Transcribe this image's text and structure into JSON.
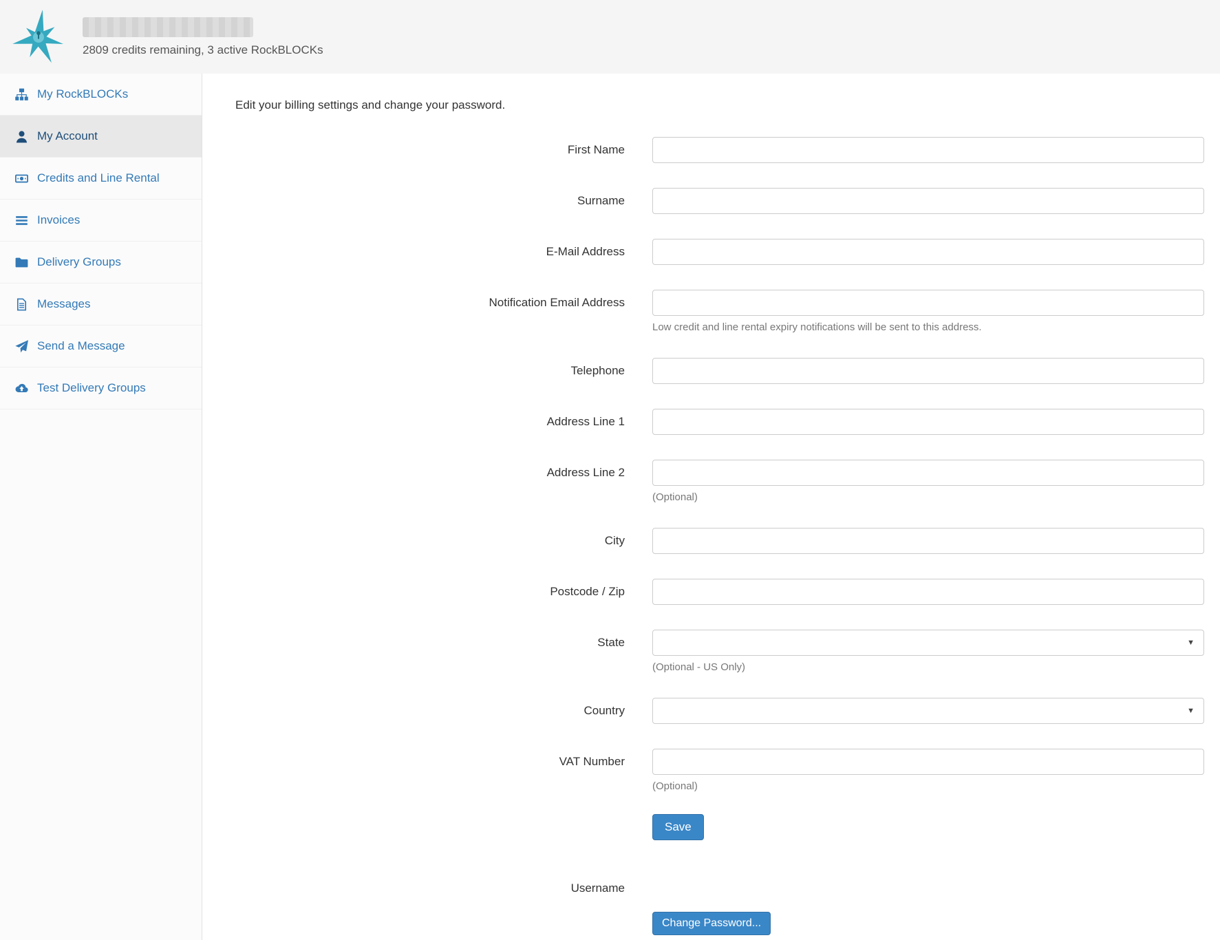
{
  "header": {
    "credits_text": "2809 credits remaining, 3 active RockBLOCKs"
  },
  "colors": {
    "accent_blue": "#3a87c8",
    "sidebar_link": "#337ab7",
    "active_item_bg": "#e8e8e8",
    "logo_teal": "#35a9c0"
  },
  "sidebar": {
    "items": [
      {
        "label": "My RockBLOCKs",
        "icon": "sitemap-icon",
        "active": false
      },
      {
        "label": "My Account",
        "icon": "user-icon",
        "active": true
      },
      {
        "label": "Credits and Line Rental",
        "icon": "money-icon",
        "active": false
      },
      {
        "label": "Invoices",
        "icon": "list-icon",
        "active": false
      },
      {
        "label": "Delivery Groups",
        "icon": "folder-icon",
        "active": false
      },
      {
        "label": "Messages",
        "icon": "file-icon",
        "active": false
      },
      {
        "label": "Send a Message",
        "icon": "paper-plane-icon",
        "active": false
      },
      {
        "label": "Test Delivery Groups",
        "icon": "cloud-upload-icon",
        "active": false
      }
    ]
  },
  "main": {
    "intro": "Edit your billing settings and change your password.",
    "form": {
      "fields": [
        {
          "label": "First Name",
          "type": "text",
          "value": ""
        },
        {
          "label": "Surname",
          "type": "text",
          "value": ""
        },
        {
          "label": "E-Mail Address",
          "type": "text",
          "value": ""
        },
        {
          "label": "Notification Email Address",
          "type": "text",
          "value": "",
          "help": "Low credit and line rental expiry notifications will be sent to this address."
        },
        {
          "label": "Telephone",
          "type": "text",
          "value": ""
        },
        {
          "label": "Address Line 1",
          "type": "text",
          "value": ""
        },
        {
          "label": "Address Line 2",
          "type": "text",
          "value": "",
          "help": "(Optional)"
        },
        {
          "label": "City",
          "type": "text",
          "value": ""
        },
        {
          "label": "Postcode / Zip",
          "type": "text",
          "value": ""
        },
        {
          "label": "State",
          "type": "select",
          "value": "",
          "help": "(Optional - US Only)"
        },
        {
          "label": "Country",
          "type": "select",
          "value": ""
        },
        {
          "label": "VAT Number",
          "type": "text",
          "value": "",
          "help": "(Optional)"
        }
      ],
      "save_label": "Save"
    },
    "account": {
      "username_label": "Username",
      "username_value": "",
      "change_password_label": "Change Password..."
    }
  }
}
